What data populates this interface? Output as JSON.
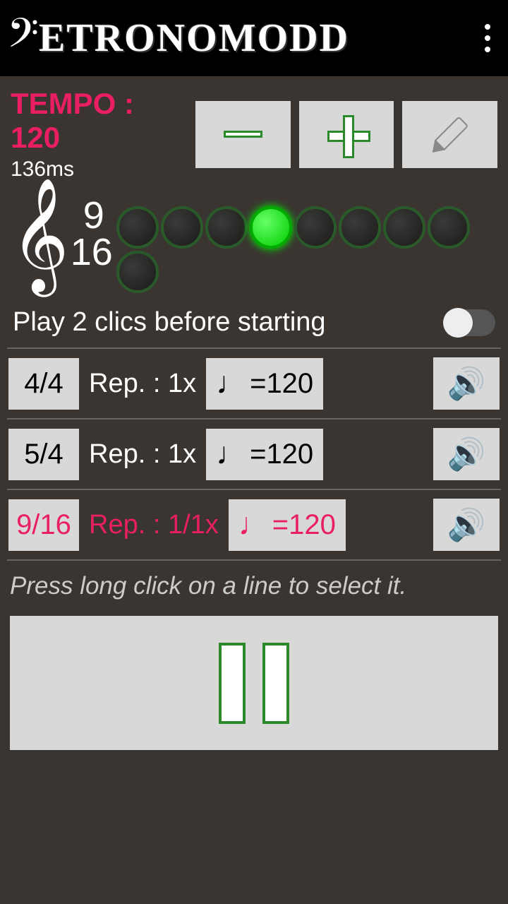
{
  "header": {
    "title": "ETRONOMODD"
  },
  "tempo": {
    "label": "TEMPO : ",
    "value": "120",
    "ms": "136ms"
  },
  "timeSig": {
    "top": "9",
    "bottom": "16"
  },
  "beats": {
    "count": 9,
    "activeIndex": 3
  },
  "preClicks": {
    "label": "Play 2 clics before starting",
    "enabled": false
  },
  "sequences": [
    {
      "sig": "4/4",
      "rep": "Rep. : 1x",
      "bpm": "=120",
      "active": false
    },
    {
      "sig": "5/4",
      "rep": "Rep. : 1x",
      "bpm": "=120",
      "active": false
    },
    {
      "sig": "9/16",
      "rep": "Rep. : 1/1x",
      "bpm": "=120",
      "active": true
    }
  ],
  "hint": "Press long click on a line to select it."
}
